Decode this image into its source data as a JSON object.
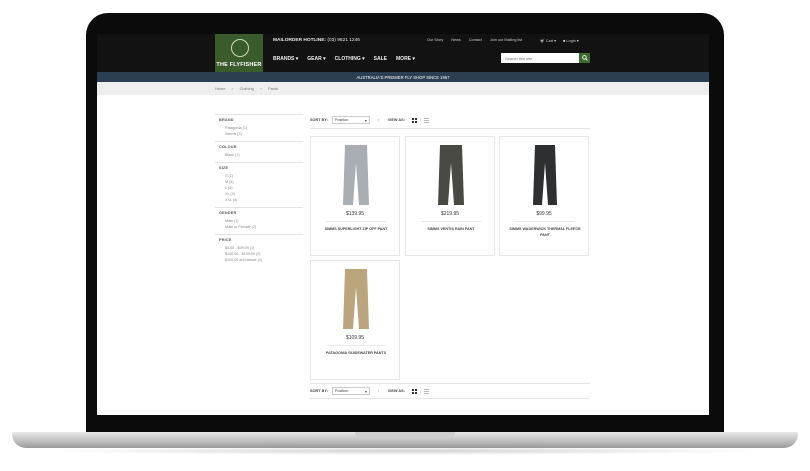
{
  "header": {
    "logo_text": "THE FLYFISHER",
    "hotline_label": "MAILORDER HOTLINE:",
    "hotline_number": "(03) 9621 1246",
    "top_links": [
      "Our Story",
      "News",
      "Contact",
      "Join our Mailing list"
    ],
    "cart_label": "Cart",
    "login_label": "Login",
    "nav": [
      "BRANDS",
      "GEAR",
      "CLOTHING",
      "SALE",
      "MORE"
    ],
    "search_placeholder": "Search this site",
    "tagline": "AUSTRALIA'S PREMIER FLY SHOP SINCE 1967"
  },
  "breadcrumb": [
    "Home",
    "Clothing",
    "Pants"
  ],
  "filters": [
    {
      "heading": "BRAND",
      "options": [
        "Patagonia (1)",
        "Simms (3)"
      ]
    },
    {
      "heading": "COLOUR",
      "options": [
        "Black (1)"
      ]
    },
    {
      "heading": "SIZE",
      "options": [
        "S (1)",
        "M (4)",
        "L (4)",
        "XL (4)",
        "XXL (4)"
      ]
    },
    {
      "heading": "GENDER",
      "options": [
        "Male (1)",
        "Male or Female (2)"
      ]
    },
    {
      "heading": "PRICE",
      "options": [
        "$0.00 - $99.99 (1)",
        "$100.00 - $199.99 (2)",
        "$200.00 and above (1)"
      ]
    }
  ],
  "toolbar": {
    "sort_label": "SORT BY:",
    "sort_value": "Position",
    "sort_dir": "↑",
    "view_label": "VIEW AS:"
  },
  "products": [
    {
      "price": "$139.95",
      "name": "SIMMS SUPERLIGHT ZIP OFF PANT",
      "color": "#a9adb4"
    },
    {
      "price": "$219.95",
      "name": "SIMMS VENTIS RAIN PANT",
      "color": "#4a4a44"
    },
    {
      "price": "$99.95",
      "name": "SIMMS WADERWICK THERMAL FLEECE PANT",
      "color": "#2e2f31"
    },
    {
      "price": "$109.95",
      "name": "PATAGONIA GUIDEWATER PANTS",
      "color": "#bba57c"
    }
  ]
}
